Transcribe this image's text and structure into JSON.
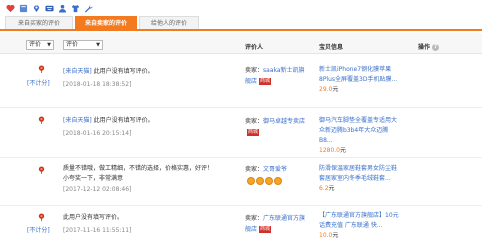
{
  "toolbar": {
    "icons": [
      "heart-icon",
      "book-icon",
      "location-pin-icon",
      "keyboard-icon",
      "person-icon",
      "shirt-icon",
      "wrench-icon"
    ]
  },
  "tabs": [
    {
      "label": "来自买家的评价"
    },
    {
      "label": "来自卖家的评价"
    },
    {
      "label": "给他人的评价"
    }
  ],
  "header": {
    "filter_rating": "评价",
    "filter_type": "评价",
    "col_reviewer": "评价人",
    "col_item": "宝贝信息",
    "col_action": "操作"
  },
  "reviews": [
    {
      "rating": "[不计分]",
      "tag": "[来自天猫]",
      "comment": "此用户没有填写评价。",
      "time": "[2018-01-18 18:38:52]",
      "seller_prefix": "卖家：",
      "seller_name": "saaka新士凯旗",
      "seller_name2": "舰店",
      "badge": "商城",
      "item_title": "新士凯iPhone7钢化膜苹果8Plus全屏覆盖3D手机贴膜...",
      "price": "29.0",
      "unit": "元"
    },
    {
      "rating": "",
      "tag": "[来自天猫]",
      "comment": "此用户没有填写评价。",
      "time": "[2018-01-16 20:15:14]",
      "seller_prefix": "卖家：",
      "seller_name": "御马卓越专卖店",
      "seller_name2": "",
      "badge": "商城",
      "item_title": "御马汽车脚垫全覆盖专适用大众新迈腾b3b4年大众迈腾B8...",
      "price": "1280.0",
      "unit": "元"
    },
    {
      "rating": "",
      "tag": "",
      "comment": "质量不错哦，做工精细，不错的选择，价格实惠，好评！\n小夸奖一下，非常满意",
      "time": "[2017-12-12 02:08:46]",
      "seller_prefix": "卖家：",
      "seller_name": "文哥爱爷",
      "seller_name2": "",
      "badge": "",
      "item_title": "防滑保温家居鞋套男女防尘鞋套居家室内冬季毛绒鞋套...",
      "price": "6.2",
      "unit": "元"
    },
    {
      "rating": "[不计分]",
      "tag": "",
      "comment": "此用户没有填写评价。",
      "time": "[2017-11-16 11:55:11]",
      "seller_prefix": "卖家：",
      "seller_name": "广东联通官方旗",
      "seller_name2": "舰店",
      "badge": "商城",
      "item_title": "【广东联通官方旗舰店】10元 话费充值 广东联通 快...",
      "price": "10.0",
      "unit": "元"
    }
  ],
  "colors": {
    "accent": "#f47a20",
    "link": "#3a6fc8",
    "badge": "#d0302a"
  }
}
